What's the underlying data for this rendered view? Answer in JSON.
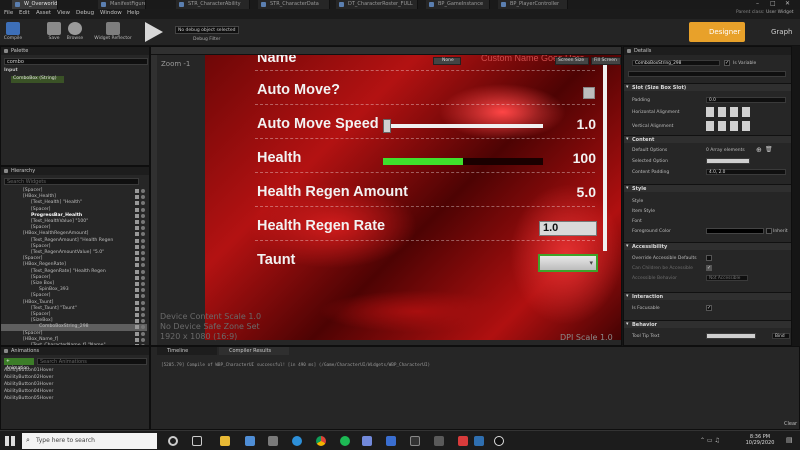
{
  "tabs": [
    "W_Overworld",
    "ManifestFigure",
    "STR_CharacterAbility",
    "STR_CharacterData",
    "DT_CharacterRoster_FULL",
    "BP_GameInstance",
    "BP_PlayerController"
  ],
  "window_controls": {
    "minimize": "–",
    "maximize": "□",
    "close": "✕"
  },
  "user": "User Widget",
  "parent_class": "Parent class:",
  "menu": [
    "File",
    "Edit",
    "Asset",
    "View",
    "Debug",
    "Window",
    "Help"
  ],
  "toolbar": {
    "compile": "Compile",
    "save": "Save",
    "browse": "Browse",
    "widget_reflector": "Widget Reflector",
    "debug_select": "No debug object selected",
    "debug_filter": "Debug Filter",
    "designer": "Designer",
    "graph": "Graph"
  },
  "palette": {
    "title": "Palette",
    "search_value": "combo",
    "group": "Input",
    "item": "ComboBox (String)"
  },
  "hierarchy": {
    "title": "Hierarchy",
    "search_placeholder": "Search Widgets",
    "rows": [
      "[Spacer]",
      "[HBox_Health]",
      "[Text_Health] \"Health\"",
      "[Spacer]",
      "ProgressBar_Health",
      "[Text_HealthValue] \"100\"",
      "[Spacer]",
      "[HBox_HealthRegenAmount]",
      "[Text_RegenAmount] \"Health Regen",
      "[Spacer]",
      "[Text_RegenAmountValue] \"5.0\"",
      "[Spacer]",
      "[HBox_RegenRate]",
      "[Text_RegenRate] \"Health Regen",
      "[Spacer]",
      "[Size Box]",
      "SpinBox_393",
      "[Spacer]",
      "[HBox_Taunt]",
      "[Text_Taunt] \"Taunt\"",
      "[Spacer]",
      "[SizeBox]",
      "ComboBoxString_298",
      "[Spacer]",
      "[HBox_Name_f]",
      "[Text_CharacterName_f] \"Name\""
    ]
  },
  "designer": {
    "zoom": "Zoom -1",
    "preview_toggle": "None",
    "screen_size": "Screen Size",
    "fill_screen": "Fill Screen",
    "name_label": "Name",
    "name_placeholder": "Custom Name Goes Here",
    "rows": [
      {
        "label": "Auto Move?",
        "value": ""
      },
      {
        "label": "Auto Move Speed",
        "value": "1.0"
      },
      {
        "label": "Health",
        "value": "100"
      },
      {
        "label": "Health Regen Amount",
        "value": "5.0"
      },
      {
        "label": "Health Regen Rate",
        "value": ""
      },
      {
        "label": "Taunt",
        "value": ""
      }
    ],
    "spinbox_value": "1.0",
    "health_fill_fraction": 0.5,
    "slider_value_fraction": 0.0,
    "device_content_scale": "Device Content Scale 1.0",
    "no_safe_zone": "No Device Safe Zone Set",
    "resolution": "1920 x 1080 (16:9)",
    "dpi": "DPI Scale 1.0"
  },
  "details": {
    "title": "Details",
    "widget_name": "ComboBoxString_298",
    "is_variable": "Is Variable",
    "sections": {
      "slot": "Slot (Size Box Slot)",
      "content": "Content",
      "style": "Style",
      "accessibility": "Accessibility",
      "interaction": "Interaction",
      "behavior": "Behavior"
    },
    "props": {
      "padding": "Padding",
      "padding_value": "0.0",
      "h_align": "Horizontal Alignment",
      "v_align": "Vertical Alignment",
      "default_options": "Default Options",
      "default_options_value": "0 Array elements",
      "selected_option": "Selected Option",
      "content_padding": "Content Padding",
      "content_padding_value": "4.0, 2.0",
      "style": "Style",
      "item_style": "Item Style",
      "font": "Font",
      "foreground_color": "Foreground Color",
      "inherit": "Inherit",
      "override_defaults": "Override Accessible Defaults",
      "can_children": "Can Children be Accessible",
      "accessible_behavior": "Accessible Behavior",
      "not_accessible": "Not Accessible",
      "is_focusable": "Is Focusable",
      "tool_tip_text": "Tool Tip Text",
      "bind": "Bind"
    }
  },
  "animations": {
    "title": "Animations",
    "add_button": "+ Animation",
    "search_placeholder": "Search Animations",
    "items": [
      "AbilityButton01Hover",
      "AbilityButton02Hover",
      "AbilityButton03Hover",
      "AbilityButton04Hover",
      "AbilityButton05Hover"
    ]
  },
  "timeline": {
    "timeline_tab": "Timeline",
    "compiler_tab": "Compiler Results",
    "log": "[5205.79] Compile of WBP_CharacterUI successful! [in 490 ms] (/Game/CharacterUI/Widgets/WBP_CharacterUI)",
    "clear": "Clear"
  },
  "taskbar": {
    "search_placeholder": "Type here to search",
    "time": "8:36 PM",
    "date": "10/29/2020"
  },
  "colors": {
    "accent": "#e8a12a",
    "health_bar": "#3fe12c",
    "selection": "#3ea32a"
  }
}
